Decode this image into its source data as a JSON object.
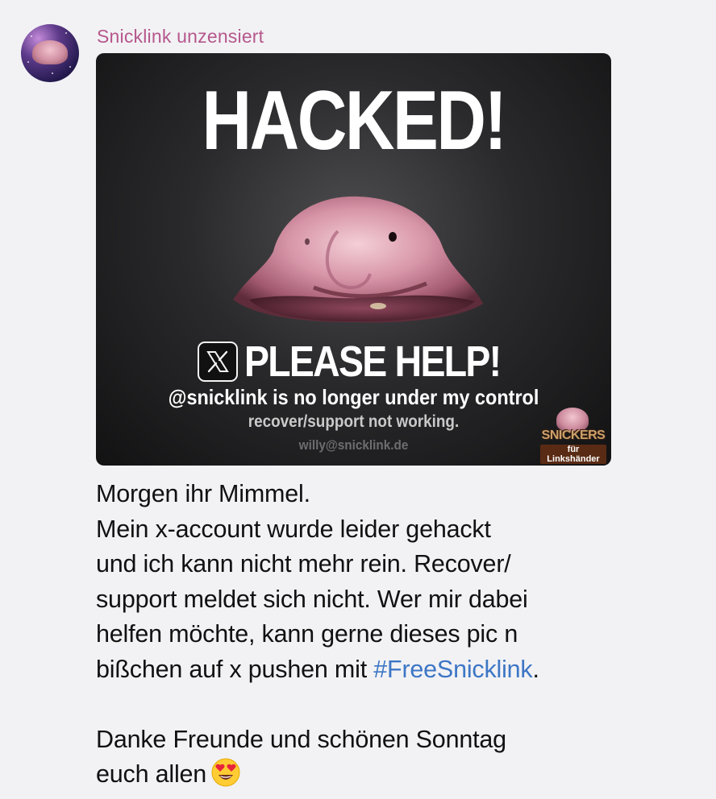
{
  "channel": {
    "name": "Snicklink unzensiert"
  },
  "image": {
    "headline": "HACKED!",
    "x_logo": "x-logo-icon",
    "help_text": "PLEASE HELP!",
    "line1": "@snicklink is no longer under my control",
    "line2": "recover/support not working.",
    "line3": "willy@snicklink.de",
    "brand_name": "SNICKERS",
    "brand_sub": "für Linkshänder"
  },
  "message": {
    "line1": "Morgen ihr Mimmel.",
    "line2": "Mein x-account wurde leider gehackt",
    "line3": "und ich kann nicht mehr rein. Recover/",
    "line4": "support meldet sich nicht. Wer mir dabei",
    "line5": "helfen möchte, kann gerne dieses pic n",
    "line6_prefix": "bißchen auf x pushen mit ",
    "hashtag": "#FreeSnicklink",
    "line6_suffix": ".",
    "line7": "Danke Freunde und schönen Sonntag",
    "line8": "euch allen",
    "emoji": "heart-eyes-emoji"
  },
  "colors": {
    "channel_name": "#b5588c",
    "hashtag": "#3d76c5",
    "background": "#f2f2f5"
  }
}
